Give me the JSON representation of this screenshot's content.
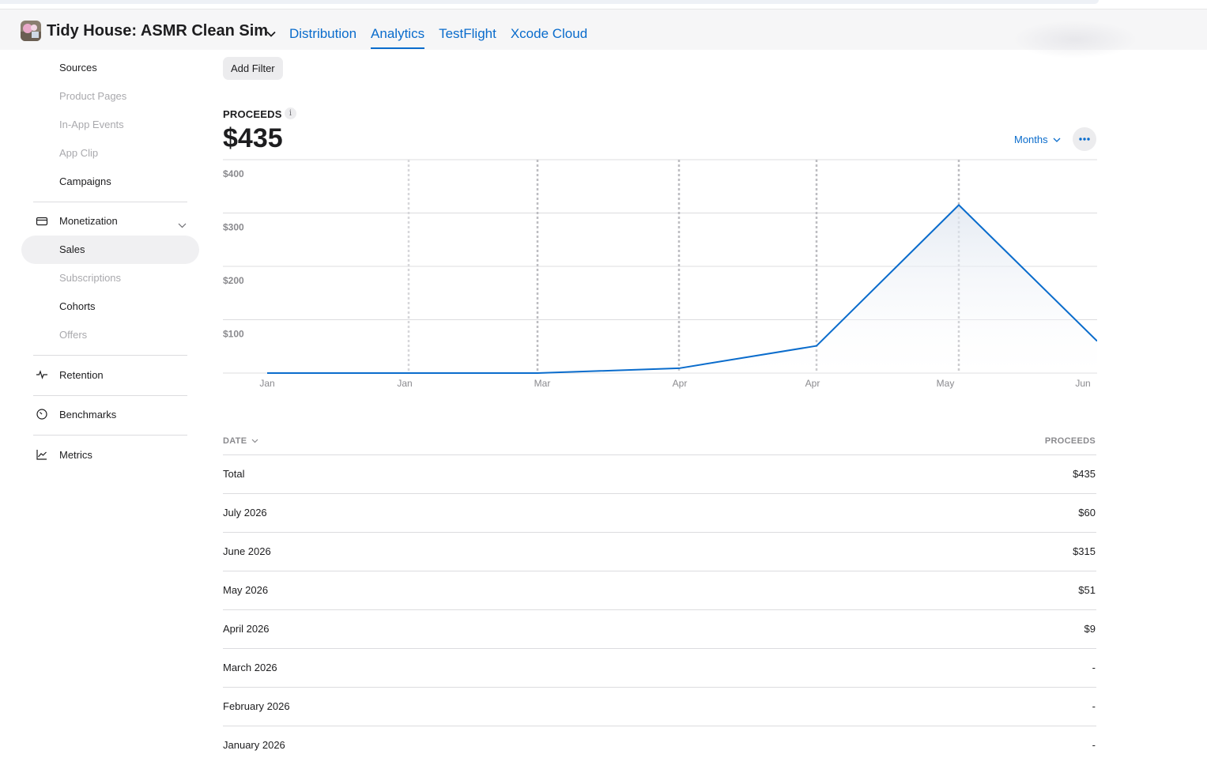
{
  "app": {
    "title": "Tidy House: ASMR Clean Sim"
  },
  "nav_tabs": [
    "Distribution",
    "Analytics",
    "TestFlight",
    "Xcode Cloud"
  ],
  "sidebar": {
    "acquisition_items": [
      "Sources",
      "Product Pages",
      "In-App Events",
      "App Clip",
      "Campaigns"
    ],
    "monetization": {
      "label": "Monetization",
      "items": [
        "Sales",
        "Subscriptions",
        "Cohorts",
        "Offers"
      ]
    },
    "retention": "Retention",
    "benchmarks": "Benchmarks",
    "metrics": "Metrics"
  },
  "filter_button": "Add Filter",
  "metric": {
    "label": "PROCEEDS",
    "value": "$435",
    "info_glyph": "i",
    "period": "Months"
  },
  "chart_data": {
    "type": "area",
    "x_labels": [
      "Jan",
      "Jan",
      "Mar",
      "Apr",
      "Apr",
      "May",
      "Jun"
    ],
    "values": [
      0,
      0,
      0,
      9,
      51,
      315,
      60
    ],
    "y_ticks": [
      "$400",
      "$300",
      "$200",
      "$100"
    ],
    "ylim": [
      0,
      400
    ],
    "line_color": "#0a6ccc",
    "grid": true
  },
  "table": {
    "headers": {
      "date": "DATE",
      "proceeds": "PROCEEDS"
    },
    "rows": [
      {
        "date": "Total",
        "value": "$435"
      },
      {
        "date": "July 2026",
        "value": "$60"
      },
      {
        "date": "June 2026",
        "value": "$315"
      },
      {
        "date": "May 2026",
        "value": "$51"
      },
      {
        "date": "April 2026",
        "value": "$9"
      },
      {
        "date": "March 2026",
        "value": "-"
      },
      {
        "date": "February 2026",
        "value": "-"
      },
      {
        "date": "January 2026",
        "value": "-"
      }
    ]
  },
  "colors": {
    "accent": "#0a6ccc",
    "header_bg": "#f6f6f7",
    "selected_bg": "#f0f0f2"
  }
}
